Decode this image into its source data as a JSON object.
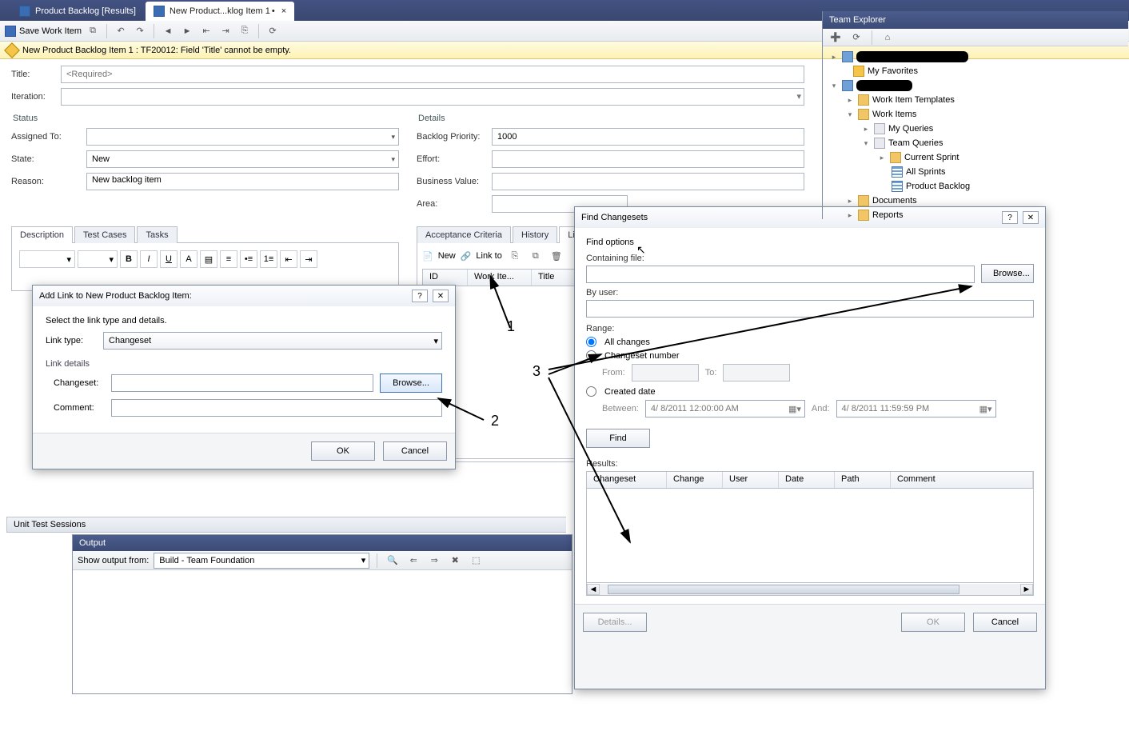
{
  "tabs": {
    "t0": "Product Backlog [Results]",
    "t1": "New Product...klog Item 1",
    "t1_dirty": "•",
    "t1_close": "×"
  },
  "toolbar": {
    "save": "Save Work Item"
  },
  "warning": "New Product Backlog Item 1 : TF20012: Field 'Title' cannot be empty.",
  "form": {
    "title_label": "Title:",
    "title_placeholder": "<Required>",
    "iteration_label": "Iteration:",
    "status_group": "Status",
    "assigned_label": "Assigned To:",
    "state_label": "State:",
    "state_value": "New",
    "reason_label": "Reason:",
    "reason_value": "New backlog item",
    "details_group": "Details",
    "priority_label": "Backlog Priority:",
    "priority_value": "1000",
    "effort_label": "Effort:",
    "bv_label": "Business Value:",
    "area_label": "Area:"
  },
  "left_tabs": {
    "desc": "Description",
    "tc": "Test Cases",
    "tasks": "Tasks"
  },
  "right_tabs": {
    "ac": "Acceptance Criteria",
    "hist": "History",
    "links": "Links"
  },
  "links_toolbar": {
    "new": "New",
    "linkto": "Link to"
  },
  "links_cols": {
    "id": "ID",
    "wi": "Work Ite...",
    "title": "Title"
  },
  "add_link": {
    "title": "Add Link to New Product Backlog Item:",
    "instr": "Select the link type and details.",
    "linktype_label": "Link type:",
    "linktype_value": "Changeset",
    "details_label": "Link details",
    "changeset_label": "Changeset:",
    "browse": "Browse...",
    "comment_label": "Comment:",
    "ok": "OK",
    "cancel": "Cancel"
  },
  "fc": {
    "title": "Find Changesets",
    "find_options": "Find options",
    "containing": "Containing file:",
    "browse": "Browse...",
    "byuser": "By user:",
    "range": "Range:",
    "all": "All changes",
    "csnum": "Changeset number",
    "from": "From:",
    "to": "To:",
    "created": "Created date",
    "between": "Between:",
    "date1": "4/ 8/2011 12:00:00 AM",
    "and": "And:",
    "date2": "4/ 8/2011 11:59:59 PM",
    "find": "Find",
    "results": "Results:",
    "cols": {
      "cs": "Changeset",
      "ch": "Change",
      "user": "User",
      "date": "Date",
      "path": "Path",
      "comment": "Comment"
    },
    "details": "Details...",
    "ok": "OK",
    "cancel": "Cancel"
  },
  "te": {
    "title": "Team Explorer",
    "fav": "My Favorites",
    "wit": "Work Item Templates",
    "wi": "Work Items",
    "mq": "My Queries",
    "tq": "Team Queries",
    "cs": "Current Sprint",
    "as": "All Sprints",
    "pb": "Product Backlog",
    "docs": "Documents",
    "rep": "Reports"
  },
  "output": {
    "title": "Output",
    "show": "Show output from:",
    "source": "Build - Team Foundation"
  },
  "uts": "Unit Test Sessions",
  "anno": {
    "n1": "1",
    "n2": "2",
    "n3": "3"
  }
}
